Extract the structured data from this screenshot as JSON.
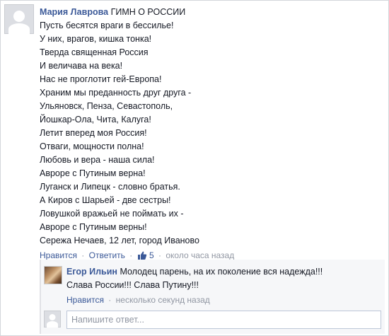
{
  "comment": {
    "author": "Мария Лаврова",
    "first_line": "ГИМН О РОССИИ",
    "lines": [
      "Пусть бесятся враги в бессилье!",
      "У них, врагов, кишка тонка!",
      "Тверда священная Россия",
      "И величава на века!",
      "Нас не проглотит гей-Европа!",
      "Храним мы преданность друг друга -",
      "Ульяновск, Пенза, Севастополь,",
      "Йошкар-Ола, Чита, Калуга!",
      "Летит вперед моя Россия!",
      "Отваги, мощности полна!",
      "Любовь и вера - наша сила!",
      "Авроре с Путиным верна!",
      "Луганск и Липецк - словно братья.",
      "А Киров с Шарьей - две сестры!",
      "Ловушкой вражьей не поймать их -",
      "Авроре с Путиным верны!",
      "Сережа Нечаев, 12 лет, город Иваново"
    ],
    "actions": {
      "like_label": "Нравится",
      "reply_label": "Ответить",
      "like_count": "5",
      "timestamp": "около часа назад"
    }
  },
  "reply": {
    "author": "Егор Ильин",
    "text_line1": "Молодец парень, на их поколение вся надежда!!!",
    "text_line2": "Слава России!!! Слава Путину!!!",
    "like_label": "Нравится",
    "timestamp": "несколько секунд назад"
  },
  "composer": {
    "placeholder": "Напишите ответ..."
  },
  "colors": {
    "link": "#3b5998",
    "muted": "#9197a3",
    "reply_bg": "#f6f7f9"
  },
  "icons": {
    "like": "thumbs-up-icon"
  }
}
